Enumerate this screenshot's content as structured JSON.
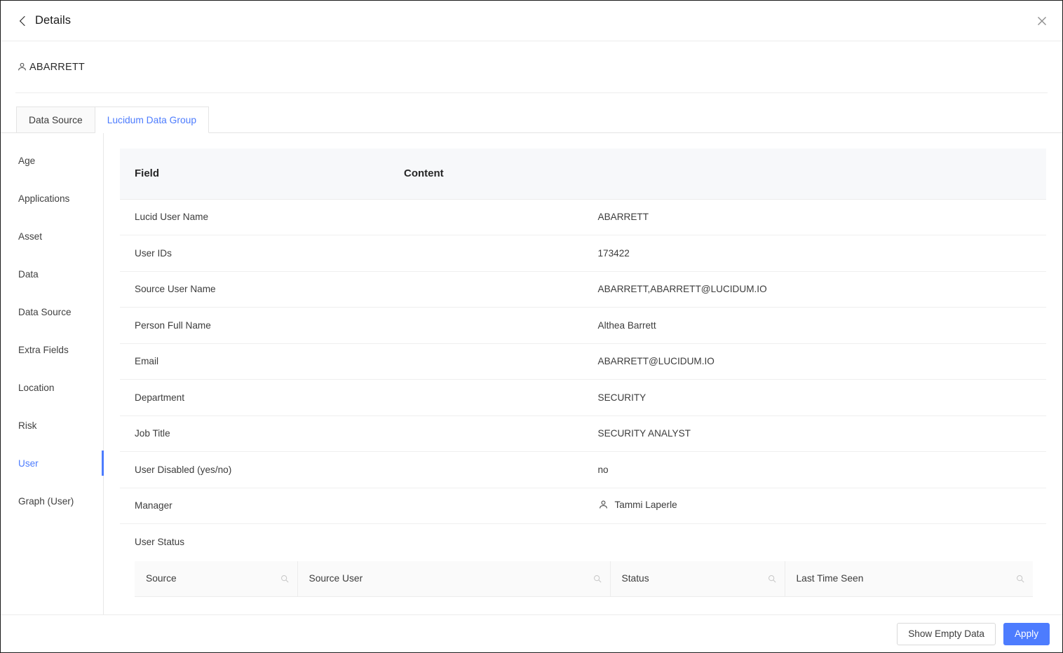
{
  "topbar": {
    "back_label": "Details",
    "back_icon": "chevron-left-icon",
    "close_icon": "close-icon"
  },
  "entity": {
    "icon": "person-icon",
    "name": "ABARRETT"
  },
  "tabs": [
    {
      "label": "Data Source",
      "active": false
    },
    {
      "label": "Lucidum Data Group",
      "active": true
    }
  ],
  "sidebar": {
    "items": [
      {
        "label": "Age",
        "active": false
      },
      {
        "label": "Applications",
        "active": false
      },
      {
        "label": "Asset",
        "active": false
      },
      {
        "label": "Data",
        "active": false
      },
      {
        "label": "Data Source",
        "active": false
      },
      {
        "label": "Extra Fields",
        "active": false
      },
      {
        "label": "Location",
        "active": false
      },
      {
        "label": "Risk",
        "active": false
      },
      {
        "label": "User",
        "active": true
      },
      {
        "label": "Graph (User)",
        "active": false
      }
    ]
  },
  "detail_table": {
    "headers": {
      "field": "Field",
      "content": "Content"
    },
    "rows": [
      {
        "field": "Lucid User Name",
        "content": "ABARRETT",
        "icon": null
      },
      {
        "field": "User IDs",
        "content": "173422",
        "icon": null
      },
      {
        "field": "Source User Name",
        "content": "ABARRETT,ABARRETT@LUCIDUM.IO",
        "icon": null
      },
      {
        "field": "Person Full Name",
        "content": "Althea Barrett",
        "icon": null
      },
      {
        "field": "Email",
        "content": "ABARRETT@LUCIDUM.IO",
        "icon": null
      },
      {
        "field": "Department",
        "content": "SECURITY",
        "icon": null
      },
      {
        "field": "Job Title",
        "content": "SECURITY ANALYST",
        "icon": null
      },
      {
        "field": "User Disabled (yes/no)",
        "content": "no",
        "icon": null
      },
      {
        "field": "Manager",
        "content": "Tammi Laperle",
        "icon": "person-icon"
      },
      {
        "field": "User Status",
        "content": "",
        "icon": null
      }
    ]
  },
  "status_table": {
    "columns": [
      {
        "label": "Source",
        "search_icon": "search-icon"
      },
      {
        "label": "Source User",
        "search_icon": "search-icon"
      },
      {
        "label": "Status",
        "search_icon": "search-icon"
      },
      {
        "label": "Last Time Seen",
        "search_icon": "search-icon"
      }
    ]
  },
  "footer": {
    "show_empty_label": "Show Empty Data",
    "apply_label": "Apply"
  },
  "colors": {
    "accent": "#4d7cfe",
    "header_bg": "#f7f8fa",
    "border": "#ececec"
  }
}
